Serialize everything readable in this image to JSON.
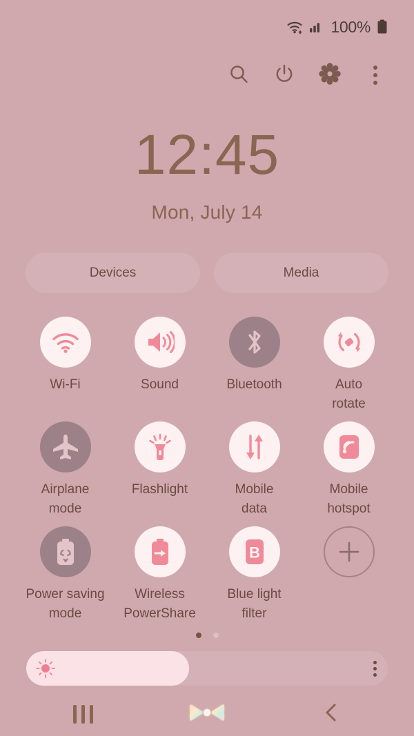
{
  "status_bar": {
    "wifi_icon": "wifi-icon",
    "signal_icon": "cellular-signal-icon",
    "battery_percent": "100%",
    "battery_icon": "battery-full-icon"
  },
  "header": {
    "search_icon": "search-icon",
    "power_icon": "power-icon",
    "settings_icon": "gear-icon",
    "more_icon": "kebab-menu-icon"
  },
  "clock": {
    "time": "12:45",
    "date": "Mon, July 14"
  },
  "pills": [
    {
      "label": "Devices",
      "name": "devices-button"
    },
    {
      "label": "Media",
      "name": "media-button"
    }
  ],
  "toggles": [
    {
      "label": "Wi-Fi",
      "icon": "wifi-icon",
      "state": "on"
    },
    {
      "label": "Sound",
      "icon": "sound-icon",
      "state": "on"
    },
    {
      "label": "Bluetooth",
      "icon": "bluetooth-icon",
      "state": "off"
    },
    {
      "label": "Auto\nrotate",
      "icon": "auto-rotate-icon",
      "state": "on"
    },
    {
      "label": "Airplane\nmode",
      "icon": "airplane-icon",
      "state": "off"
    },
    {
      "label": "Flashlight",
      "icon": "flashlight-icon",
      "state": "on"
    },
    {
      "label": "Mobile\ndata",
      "icon": "mobile-data-icon",
      "state": "on"
    },
    {
      "label": "Mobile\nhotspot",
      "icon": "mobile-hotspot-icon",
      "state": "on"
    },
    {
      "label": "Power saving\nmode",
      "icon": "power-saving-icon",
      "state": "off"
    },
    {
      "label": "Wireless\nPowerShare",
      "icon": "wireless-powershare-icon",
      "state": "on"
    },
    {
      "label": "Blue light\nfilter",
      "icon": "blue-light-filter-icon",
      "state": "on"
    },
    {
      "label": "",
      "icon": "plus-icon",
      "state": "add"
    }
  ],
  "pagination": {
    "pages": 2,
    "current": 1
  },
  "brightness": {
    "level_percent": 45,
    "sun_icon": "brightness-sun-icon",
    "more_icon": "kebab-menu-icon"
  },
  "nav_bar": {
    "recents": "recents-icon",
    "home": "home-bow-icon",
    "back": "back-chevron-icon"
  },
  "colors": {
    "background": "#cfa9ae",
    "accent_pink": "#f08a99",
    "text_brown": "#6b4a42",
    "clock_brown": "#8a6552",
    "toggle_on_bg": "#fdf1f1",
    "toggle_off_bg": "#9c8288"
  }
}
